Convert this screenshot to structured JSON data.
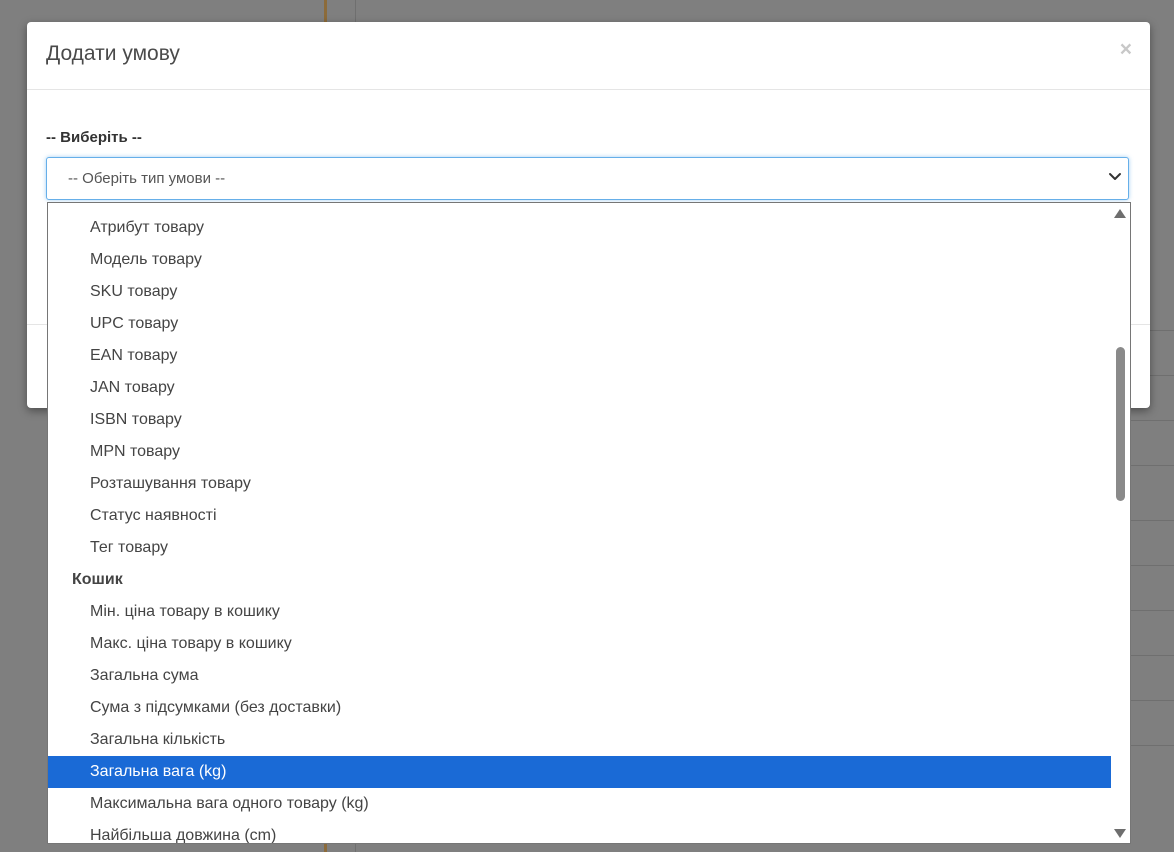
{
  "modal": {
    "title": "Додати умову",
    "close_glyph": "×",
    "field_label": "-- Виберіть --",
    "select": {
      "selected_value": "-- Оберіть тип умови --",
      "chevron_icon": "chevron-down-icon"
    }
  },
  "dropdown": {
    "items": [
      {
        "kind": "option",
        "label": "Атрибут товару"
      },
      {
        "kind": "option",
        "label": "Модель товару"
      },
      {
        "kind": "option",
        "label": "SKU товару"
      },
      {
        "kind": "option",
        "label": "UPC товару"
      },
      {
        "kind": "option",
        "label": "EAN товару"
      },
      {
        "kind": "option",
        "label": "JAN товару"
      },
      {
        "kind": "option",
        "label": "ISBN товару"
      },
      {
        "kind": "option",
        "label": "MPN товару"
      },
      {
        "kind": "option",
        "label": "Розташування товару"
      },
      {
        "kind": "option",
        "label": "Статус наявності"
      },
      {
        "kind": "option",
        "label": "Тег товару"
      },
      {
        "kind": "group",
        "label": "Кошик"
      },
      {
        "kind": "option",
        "label": "Мін. ціна товару в кошику"
      },
      {
        "kind": "option",
        "label": "Макс. ціна товару в кошику"
      },
      {
        "kind": "option",
        "label": "Загальна сума"
      },
      {
        "kind": "option",
        "label": "Сума з підсумками (без доставки)"
      },
      {
        "kind": "option",
        "label": "Загальна кількість"
      },
      {
        "kind": "option",
        "label": "Загальна вага (kg)",
        "selected": true
      },
      {
        "kind": "option",
        "label": "Максимальна вага одного товару (kg)"
      },
      {
        "kind": "option",
        "label": "Найбільша довжина (cm)"
      }
    ],
    "highlight_color": "#1a6ad6"
  }
}
